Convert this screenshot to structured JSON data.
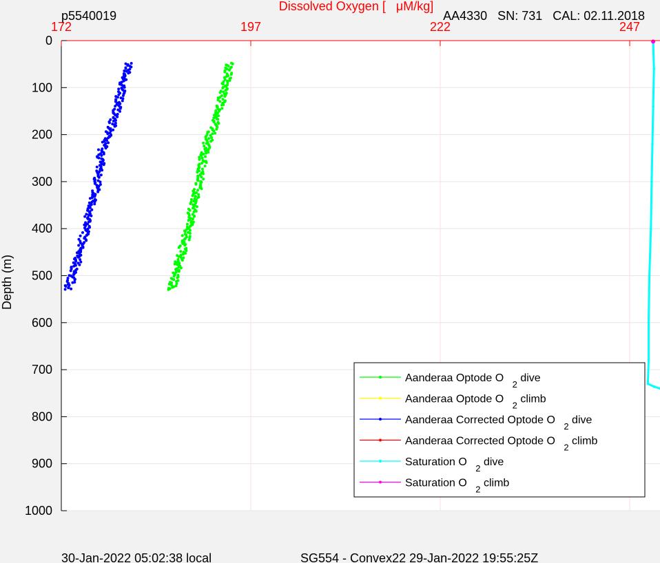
{
  "header": {
    "left": "p5540019",
    "right": "AA4330   SN: 731   CAL: 02.11.2018"
  },
  "footer": {
    "left": "30-Jan-2022 05:02:38 local",
    "center": "SG554 - Convex22 29-Jan-2022 19:55:25Z"
  },
  "colors": {
    "figure_bg": "#f2f2f2",
    "axes_bg": "#ffffff",
    "top_axis": "#ff0000",
    "grid_y": "#e6e6e6",
    "grid_x": "#ffdddd"
  },
  "chart_data": {
    "type": "scatter",
    "xlabel_top": "Dissolved Oxygen [   μM/kg]",
    "ylabel": "Depth (m)",
    "xlim": [
      172,
      251
    ],
    "ylim": [
      0,
      1000
    ],
    "y_reversed": true,
    "xticks": [
      172,
      197,
      222,
      247
    ],
    "xtick_labels": [
      "172",
      "197",
      "222",
      "247"
    ],
    "yticks": [
      0,
      100,
      200,
      300,
      400,
      500,
      600,
      700,
      800,
      900,
      1000
    ],
    "ytick_labels": [
      "0",
      "100",
      "200",
      "300",
      "400",
      "500",
      "600",
      "700",
      "800",
      "900",
      "1000"
    ],
    "grid": true,
    "legend_position": "bottom-right",
    "series": [
      {
        "name": "Aanderaa Optode O",
        "name_sub": "2",
        "name_suffix": " dive",
        "color": "#00ff00",
        "marker": "dot",
        "points": [
          [
            194.2,
            48
          ],
          [
            194.0,
            70
          ],
          [
            193.6,
            95
          ],
          [
            193.2,
            120
          ],
          [
            192.9,
            145
          ],
          [
            192.4,
            170
          ],
          [
            191.8,
            195
          ],
          [
            191.3,
            215
          ],
          [
            190.8,
            240
          ],
          [
            190.5,
            270
          ],
          [
            190.2,
            300
          ],
          [
            189.8,
            330
          ],
          [
            189.3,
            360
          ],
          [
            188.9,
            390
          ],
          [
            188.4,
            420
          ],
          [
            187.9,
            450
          ],
          [
            187.4,
            480
          ],
          [
            187.0,
            505
          ],
          [
            186.6,
            530
          ]
        ]
      },
      {
        "name": "Aanderaa Optode O",
        "name_sub": "2",
        "name_suffix": " climb",
        "color": "#ffff00",
        "marker": "dot",
        "points": []
      },
      {
        "name": "Aanderaa Corrected Optode O",
        "name_sub": "2",
        "name_suffix": " dive",
        "color": "#0000ff",
        "marker": "dot",
        "points": [
          [
            180.9,
            48
          ],
          [
            180.5,
            70
          ],
          [
            180.1,
            95
          ],
          [
            179.7,
            120
          ],
          [
            179.4,
            145
          ],
          [
            178.9,
            170
          ],
          [
            178.3,
            195
          ],
          [
            177.8,
            215
          ],
          [
            177.3,
            240
          ],
          [
            177.1,
            270
          ],
          [
            176.8,
            300
          ],
          [
            176.3,
            330
          ],
          [
            175.9,
            360
          ],
          [
            175.4,
            390
          ],
          [
            174.9,
            420
          ],
          [
            174.3,
            450
          ],
          [
            173.9,
            480
          ],
          [
            173.4,
            505
          ],
          [
            172.9,
            530
          ]
        ]
      },
      {
        "name": "Aanderaa Corrected Optode O",
        "name_sub": "2",
        "name_suffix": " climb",
        "color": "#ff0000",
        "marker": "dot",
        "points": []
      },
      {
        "name": "Saturation O",
        "name_sub": "2",
        "name_suffix": " dive",
        "color": "#00ffff",
        "marker": "line",
        "points": [
          [
            250.1,
            5
          ],
          [
            250.2,
            60
          ],
          [
            250.1,
            140
          ],
          [
            250.0,
            220
          ],
          [
            249.9,
            300
          ],
          [
            249.8,
            400
          ],
          [
            249.6,
            500
          ],
          [
            249.5,
            600
          ],
          [
            249.5,
            680
          ],
          [
            249.4,
            730
          ],
          [
            250.2,
            736
          ],
          [
            251.0,
            740
          ]
        ]
      },
      {
        "name": "Saturation O",
        "name_sub": "2",
        "name_suffix": " climb",
        "color": "#ff00ff",
        "marker": "dot",
        "points": [
          [
            250.1,
            2
          ]
        ]
      }
    ]
  }
}
